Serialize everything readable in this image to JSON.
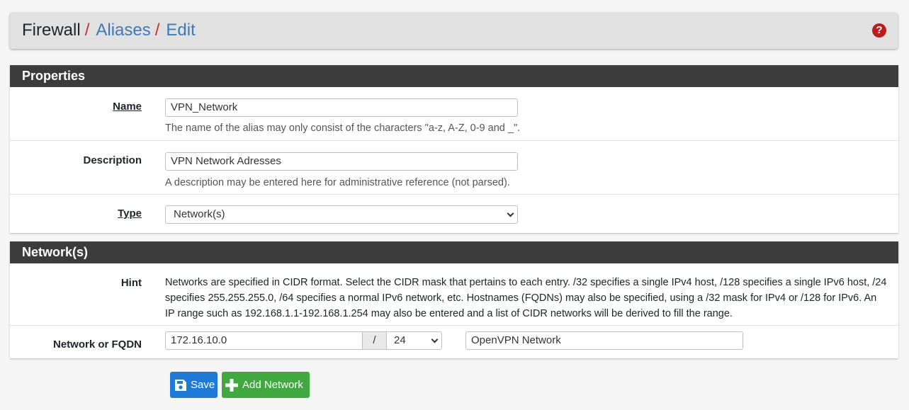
{
  "breadcrumb": {
    "root": "Firewall",
    "sep1": "/",
    "link1": "Aliases",
    "sep2": "/",
    "link2": "Edit"
  },
  "help_icon": "question-circle-icon",
  "properties": {
    "heading": "Properties",
    "name": {
      "label": "Name",
      "value": "VPN_Network",
      "help": "The name of the alias may only consist of the characters \"a-z, A-Z, 0-9 and _\"."
    },
    "description": {
      "label": "Description",
      "value": "VPN Network Adresses",
      "help": "A description may be entered here for administrative reference (not parsed)."
    },
    "type": {
      "label": "Type",
      "selected": "Network(s)"
    }
  },
  "networks": {
    "heading": "Network(s)",
    "hint_label": "Hint",
    "hint": "Networks are specified in CIDR format. Select the CIDR mask that pertains to each entry. /32 specifies a single IPv4 host, /128 specifies a single IPv6 host, /24 specifies 255.255.255.0, /64 specifies a normal IPv6 network, etc. Hostnames (FQDNs) may also be specified, using a /32 mask for IPv4 or /128 for IPv6. An IP range such as 192.168.1.1-192.168.1.254 may also be entered and a list of CIDR networks will be derived to fill the range.",
    "entry_label": "Network or FQDN",
    "address": "172.16.10.0",
    "slash": "/",
    "mask": "24",
    "entry_description": "OpenVPN Network"
  },
  "buttons": {
    "save": "Save",
    "add_network": "Add Network"
  },
  "colors": {
    "save_button": "#1e7ad6",
    "add_button": "#3fa83f",
    "panel_heading": "#3c3c3c",
    "breadcrumb_link": "#3f79b5",
    "breadcrumb_separator": "#c9302c"
  }
}
